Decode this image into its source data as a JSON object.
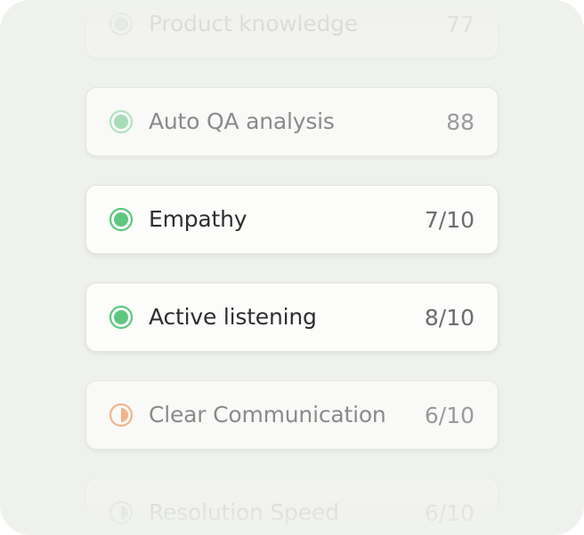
{
  "metrics": [
    {
      "label": "Product knowledge",
      "score": "77",
      "status": "complete",
      "dot_color": "#9bdab0",
      "emphasis": "faded"
    },
    {
      "label": "Auto QA analysis",
      "score": "88",
      "status": "complete",
      "dot_color": "#9bdab0",
      "emphasis": "muted"
    },
    {
      "label": "Empathy",
      "score": "7/10",
      "status": "complete",
      "dot_color": "#5ec77f",
      "emphasis": "active"
    },
    {
      "label": "Active listening",
      "score": "8/10",
      "status": "complete",
      "dot_color": "#5ec77f",
      "emphasis": "active"
    },
    {
      "label": "Clear Communication",
      "score": "6/10",
      "status": "partial",
      "dot_color": "#eea372",
      "emphasis": "muted"
    },
    {
      "label": "Resolution Speed",
      "score": "6/10",
      "status": "partial",
      "dot_color": "#b8b8b8",
      "emphasis": "faded"
    }
  ]
}
